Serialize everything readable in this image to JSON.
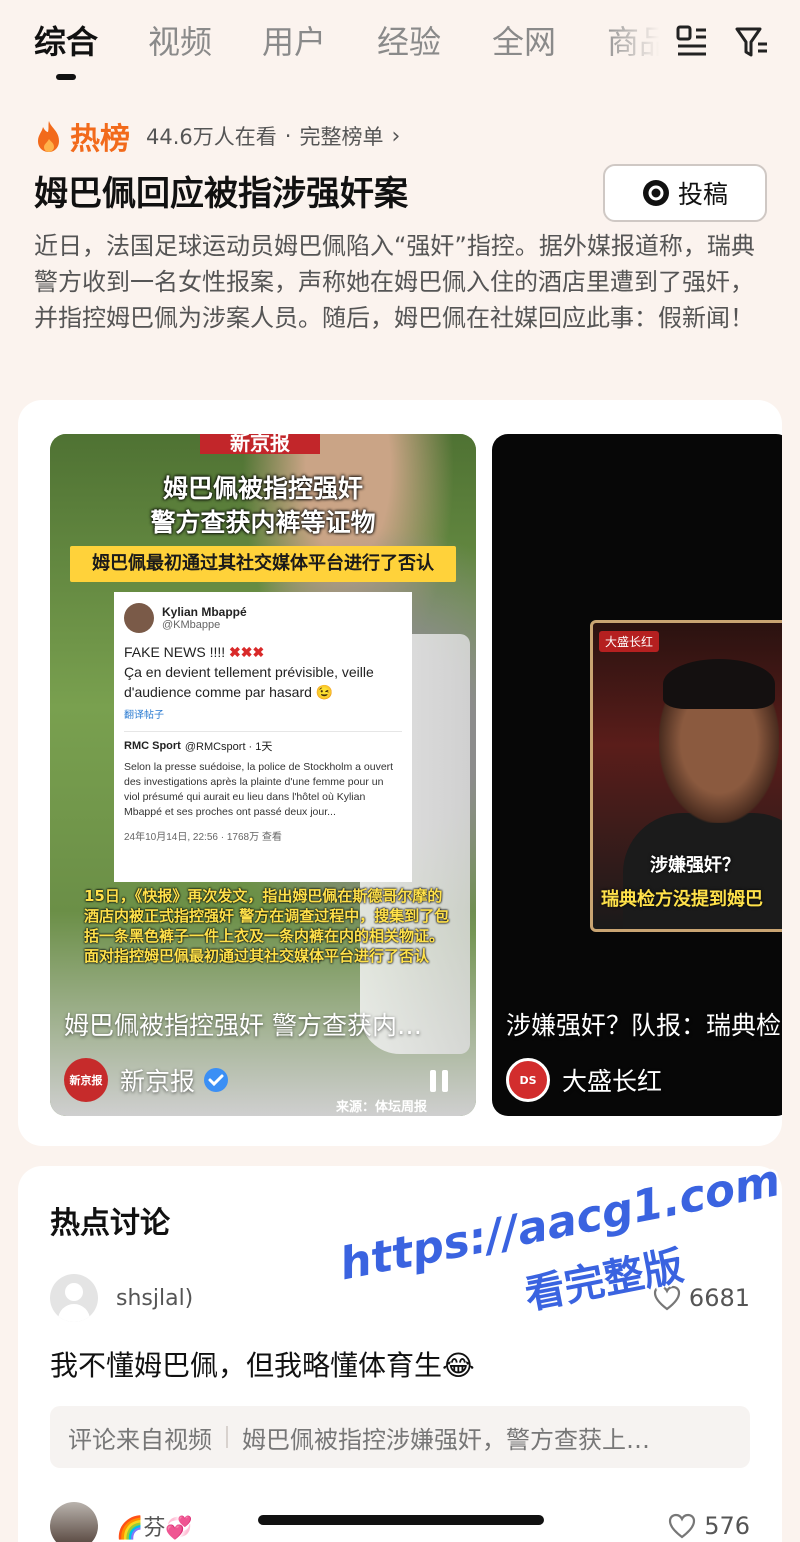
{
  "tabs": [
    "综合",
    "视频",
    "用户",
    "经验",
    "全网",
    "商品"
  ],
  "active_tab": 0,
  "top_icons": [
    "list-icon",
    "filter-icon"
  ],
  "hot": {
    "label": "热榜",
    "viewers": "44.6万人在看",
    "separator": "·",
    "full_list": "完整榜单",
    "chevron": "›"
  },
  "headline": "姆巴佩回应被指涉强奸案",
  "submit_button": "投稿",
  "summary": "近日，法国足球运动员姆巴佩陷入“强奸”指控。据外媒报道称，瑞典警方收到一名女性报案，声称她在姆巴佩入住的酒店里遭到了强奸，并指控姆巴佩为涉案人员。随后，姆巴佩在社媒回应此事：假新闻！",
  "videos": [
    {
      "overlay_brand": "新京报",
      "overlay_title": "姆巴佩被指控强奸\n警方查获内裤等证物",
      "overlay_banner": "姆巴佩最初通过其社交媒体平台进行了否认",
      "tweet": {
        "name": "Kylian Mbappé",
        "handle": "@KMbappe",
        "body_prefix": "FAKE NEWS !!!! ",
        "body_x": "✖✖✖",
        "body_rest": "Ça en devient tellement prévisible, veille d'audience comme par hasard 😉",
        "translate": "翻译帖子",
        "quote_name": "RMC Sport",
        "quote_handle": "@RMCsport · 1天",
        "quote_body": "Selon la presse suédoise, la police de Stockholm a ouvert des investigations après la plainte d'une femme pour un viol présumé qui aurait eu lieu dans l'hôtel où Kylian Mbappé et ses proches ont passé deux jour...",
        "footer": "24年10月14日, 22:56 · 1768万 查看"
      },
      "overlay_caption": "15日，《快报》再次发文，指出姆巴佩在斯德哥尔摩的酒店内被正式指控强奸 警方在调查过程中，搜集到了包括一条黑色裤子一件上衣及一条内裤在内的相关物证。面对指控姆巴佩最初通过其社交媒体平台进行了否认",
      "title": "姆巴佩被指控强奸 警方查获内…",
      "author": "新京报",
      "author_avatar_text": "新京报",
      "verified": true,
      "source_note": "来源：体坛周报"
    },
    {
      "overlay_tag": "大盛长红",
      "overlay_caption1": "涉嫌强奸？",
      "overlay_caption2": "瑞典检方没提到姆巴",
      "title": "涉嫌强奸？队报：瑞典检",
      "author": "大盛长红",
      "author_avatar_text": "DS"
    }
  ],
  "discussion": {
    "title": "热点讨论",
    "comments": [
      {
        "user": "shsjlal)",
        "likes": "6681",
        "text": "我不懂姆巴佩，但我略懂体育生😂",
        "source_label": "评论来自视频",
        "source_video": "姆巴佩被指控涉嫌强奸，警方查获上…"
      },
      {
        "user": "🌈芬💞",
        "likes": "576"
      }
    ]
  },
  "watermark": {
    "url": "https://aacg1.com",
    "text": "看完整版"
  },
  "colors": {
    "accent": "#f26a1b",
    "background": "#fbf3ee",
    "watermark": "#3a63e0"
  }
}
